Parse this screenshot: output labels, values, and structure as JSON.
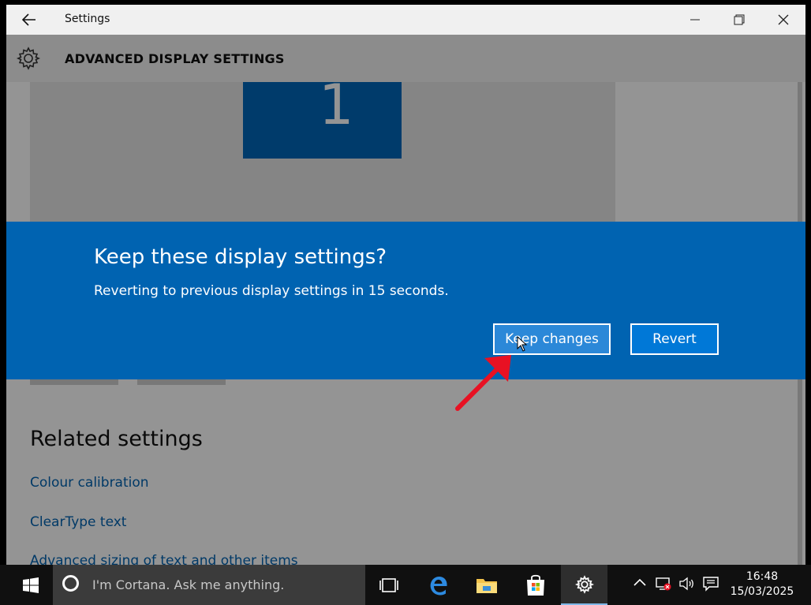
{
  "window": {
    "title": "Settings",
    "back_icon": "back-arrow-icon",
    "minimize_icon": "minimize-icon",
    "maximize_icon": "restore-icon",
    "close_icon": "close-icon"
  },
  "header": {
    "title": "ADVANCED DISPLAY SETTINGS",
    "icon": "gear-icon"
  },
  "display_preview": {
    "monitor_label": "1"
  },
  "related": {
    "heading": "Related settings",
    "links": [
      "Colour calibration",
      "ClearType text",
      "Advanced sizing of text and other items"
    ]
  },
  "dialog": {
    "title": "Keep these display settings?",
    "message": "Reverting to previous display settings in 15 seconds.",
    "keep_label": "Keep changes",
    "revert_label": "Revert"
  },
  "taskbar": {
    "search_placeholder": "I'm Cortana. Ask me anything.",
    "apps": [
      "task-view-icon",
      "edge-icon",
      "file-explorer-icon",
      "store-icon",
      "settings-icon"
    ],
    "tray_icons": [
      "chevron-up-icon",
      "network-icon",
      "volume-icon",
      "notifications-icon"
    ],
    "time": "16:48",
    "date": "15/03/2025"
  },
  "colors": {
    "accent": "#0063b1",
    "annotation_arrow": "#e81123"
  }
}
